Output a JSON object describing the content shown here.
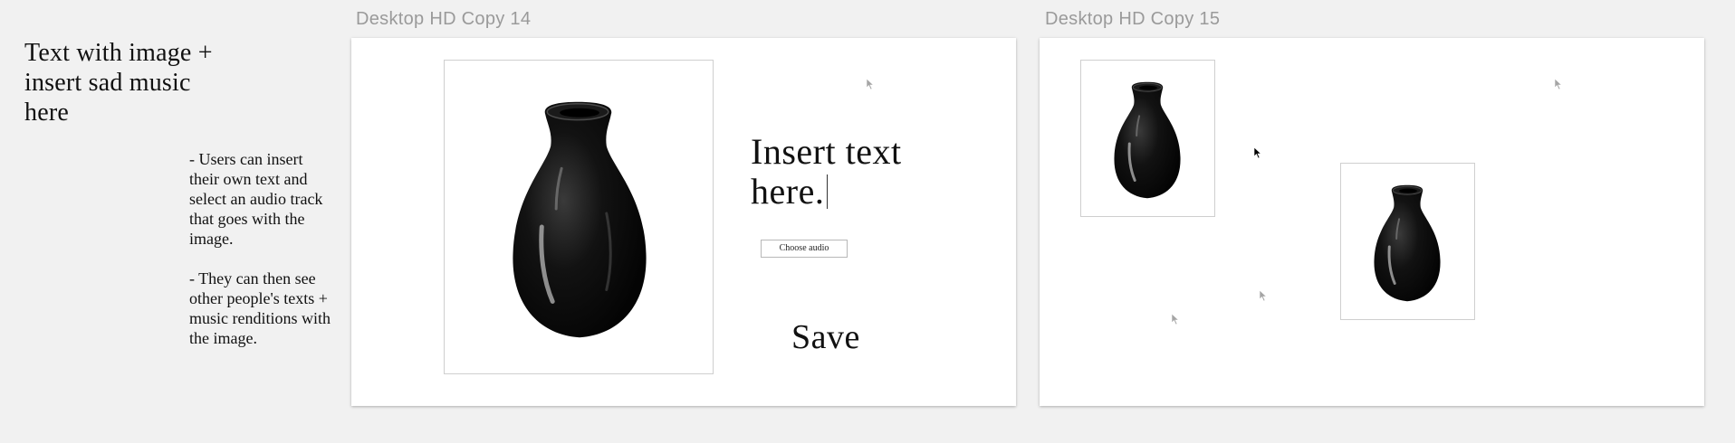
{
  "notes": {
    "title": "Text with image +\ninsert sad music\nhere",
    "bullets": [
      "- Users can insert their own text and select an audio track that goes with the image.",
      "- They can then see other people's texts + music renditions with the image."
    ]
  },
  "artboards": [
    {
      "label": "Desktop HD Copy 14",
      "insert_text": "Insert text\nhere.",
      "choose_audio_label": "Choose audio",
      "save_label": "Save"
    },
    {
      "label": "Desktop HD Copy 15"
    }
  ],
  "icons": {
    "vase": "vase-image",
    "pointer": "cursor-pointer-icon"
  },
  "colors": {
    "canvas_background": "#f1f1f1",
    "artboard_background": "#ffffff",
    "label_gray": "#9a9a9a",
    "vase_black": "#0b0b0b"
  }
}
